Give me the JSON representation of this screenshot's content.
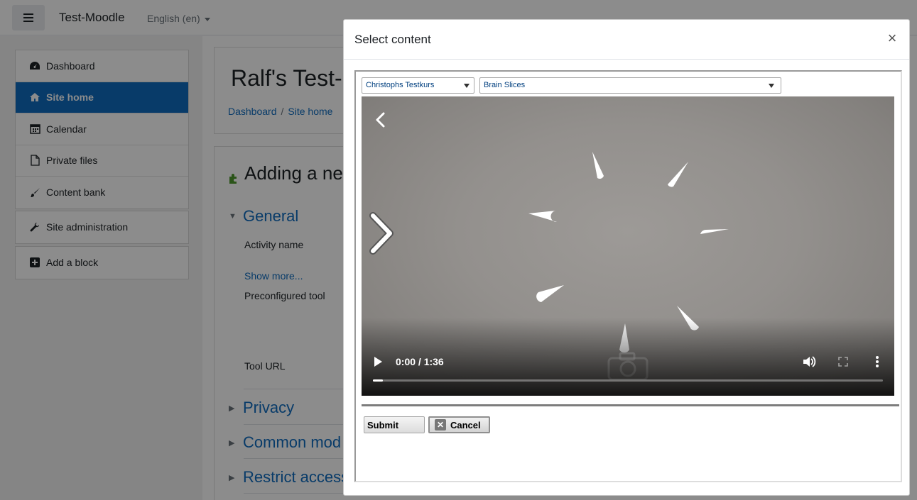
{
  "navbar": {
    "site_name": "Test-Moodle",
    "language": "English (en)"
  },
  "nav_drawer": {
    "items": [
      {
        "label": "Dashboard",
        "icon": "dashboard-icon"
      },
      {
        "label": "Site home",
        "icon": "home-icon",
        "active": true
      },
      {
        "label": "Calendar",
        "icon": "calendar-icon"
      },
      {
        "label": "Private files",
        "icon": "file-icon"
      },
      {
        "label": "Content bank",
        "icon": "brush-icon"
      }
    ],
    "admin": {
      "label": "Site administration",
      "icon": "wrench-icon"
    },
    "add_block": {
      "label": "Add a block",
      "icon": "plus-square-icon"
    }
  },
  "page": {
    "title": "Ralf's Test-",
    "breadcrumb": [
      "Dashboard",
      "Site home"
    ],
    "form_heading": "Adding a ne",
    "sections": {
      "general": "General",
      "privacy": "Privacy",
      "common_modules": "Common mod",
      "restrict_access": "Restrict access"
    },
    "fields": {
      "activity_name": "Activity name",
      "show_more": "Show more...",
      "preconfigured_tool": "Preconfigured tool",
      "tool_url": "Tool URL"
    }
  },
  "modal": {
    "title": "Select content",
    "close": "×",
    "course_select": "Christophs Testkurs",
    "content_select": "Brain Slices",
    "video": {
      "time": "0:00 / 1:36",
      "progress": 0.0
    },
    "submit_label": "Submit",
    "cancel_label": "Cancel"
  },
  "colors": {
    "primary": "#0f6cbf",
    "overlay": "rgba(0,0,0,0.45)"
  }
}
